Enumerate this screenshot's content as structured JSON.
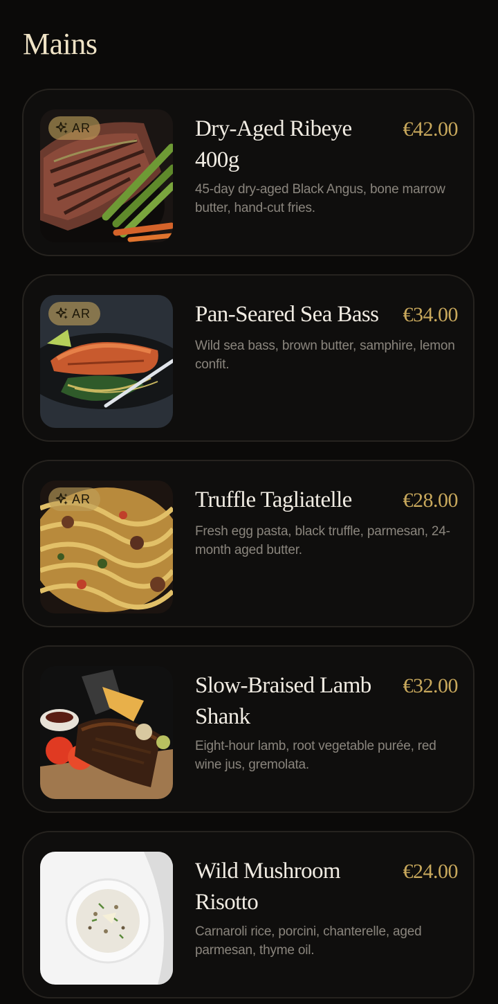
{
  "section": {
    "title": "Mains"
  },
  "colors": {
    "background": "#0b0a09",
    "card": "#0f0e0d",
    "card_border": "#26231f",
    "title": "#efe3c6",
    "dish_name": "#f1ece3",
    "price": "#c8a85c",
    "description": "#8a857d",
    "ar_badge": "#bea05a"
  },
  "items": [
    {
      "name": "Dry-Aged Ribeye 400g",
      "price": "€42.00",
      "description": "45-day dry-aged Black Angus, bone marrow butter, hand-cut fries.",
      "ar_label": "AR",
      "icons": [
        "ar-sparkle-icon"
      ]
    },
    {
      "name": "Pan-Seared Sea Bass",
      "price": "€34.00",
      "description": "Wild sea bass, brown butter, samphire, lemon confit.",
      "ar_label": "AR",
      "icons": [
        "ar-sparkle-icon"
      ]
    },
    {
      "name": "Truffle Tagliatelle",
      "price": "€28.00",
      "description": "Fresh egg pasta, black truffle, parmesan, 24-month aged butter.",
      "ar_label": "AR",
      "icons": [
        "ar-sparkle-icon"
      ]
    },
    {
      "name": "Slow-Braised Lamb Shank",
      "price": "€32.00",
      "description": "Eight-hour lamb, root vegetable purée, red wine jus, gremolata."
    },
    {
      "name": "Wild Mushroom Risotto",
      "price": "€24.00",
      "description": "Carnaroli rice, porcini, chanterelle, aged parmesan, thyme oil."
    }
  ]
}
